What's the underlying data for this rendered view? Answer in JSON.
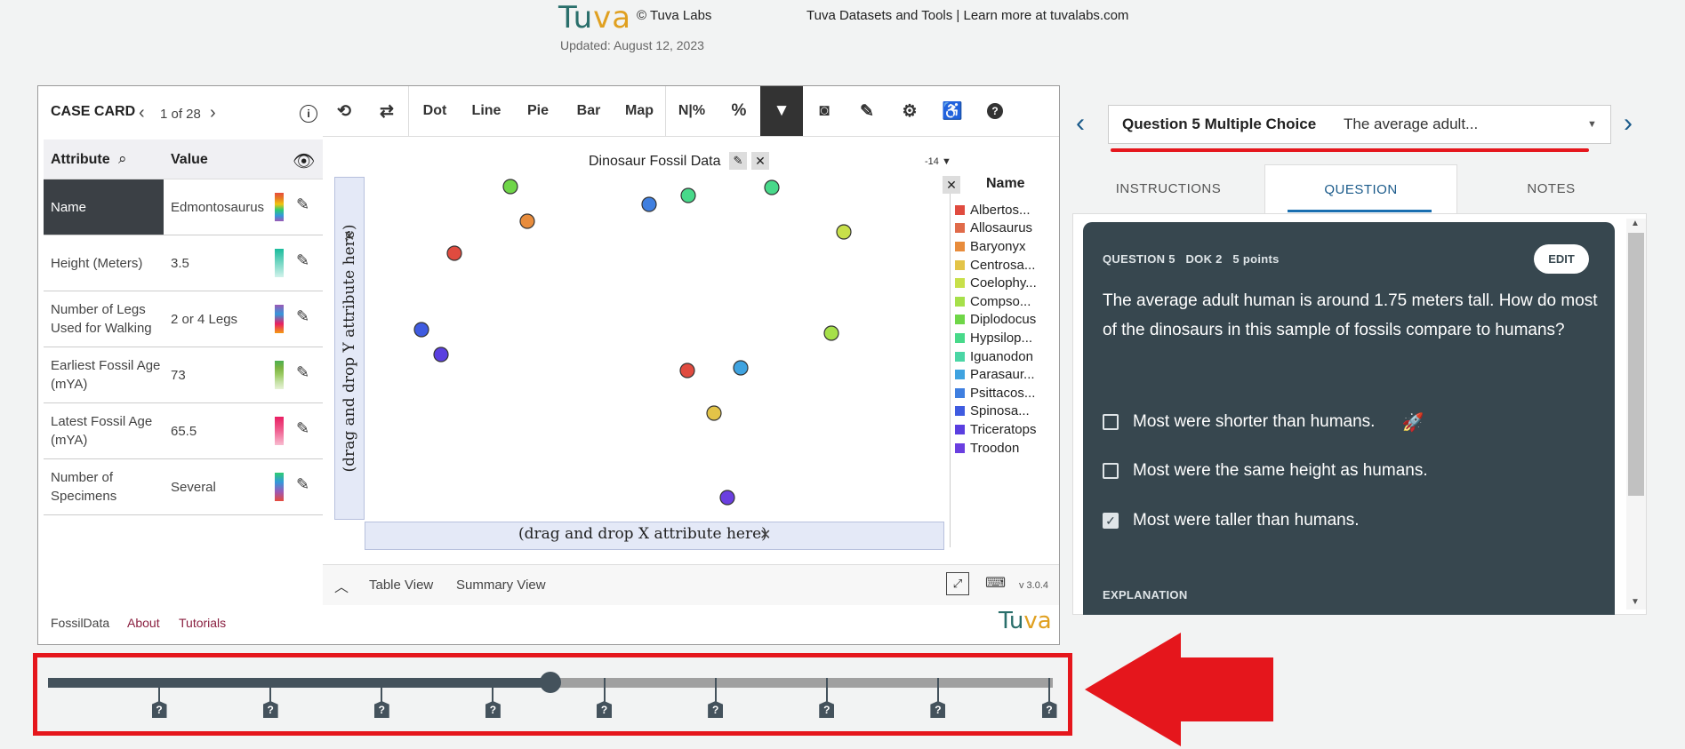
{
  "header": {
    "logo_text": "Tuva",
    "copyright": "© Tuva Labs",
    "updated": "Updated: August 12, 2023",
    "datasets_line": "Tuva Datasets and Tools | Learn more at tuvalabs.com"
  },
  "case_card": {
    "title": "CASE CARD",
    "position": "1 of 28",
    "col_attribute": "Attribute",
    "col_value": "Value",
    "rows": [
      {
        "attr": "Name",
        "value": "Edmontosaurus",
        "swatch": [
          "#e74c3c",
          "#e67e22",
          "#f1c40f",
          "#2ecc71",
          "#3498db",
          "#9b59b6"
        ]
      },
      {
        "attr": "Height (Meters)",
        "value": "3.5",
        "swatch": [
          "#1abc9c",
          "#48c9b0",
          "#76d7c4",
          "#a3e4d7",
          "#d1f2eb"
        ]
      },
      {
        "attr": "Number of Legs Used for Walking",
        "value": "2 or 4 Legs",
        "swatch": [
          "#9b59b6",
          "#3498db",
          "#e91e63",
          "#f39c12"
        ]
      },
      {
        "attr": "Earliest Fossil Age (mYA)",
        "value": "73",
        "swatch": [
          "#4caf50",
          "#7cb342",
          "#9ccc65",
          "#c5e1a5",
          "#e6f2d6"
        ]
      },
      {
        "attr": "Latest Fossil Age (mYA)",
        "value": "65.5",
        "swatch": [
          "#e91e63",
          "#ec407a",
          "#f06292",
          "#f48fb1",
          "#f8bbd0"
        ]
      },
      {
        "attr": "Number of Specimens",
        "value": "Several",
        "swatch": [
          "#2ecc71",
          "#3498db",
          "#9b59b6",
          "#e74c3c"
        ]
      }
    ]
  },
  "toolbar": {
    "dot": "Dot",
    "line": "Line",
    "pie": "Pie",
    "bar": "Bar",
    "map": "Map",
    "npct": "N|%"
  },
  "graph": {
    "title": "Dinosaur Fossil Data",
    "filter_count": "-14",
    "y_placeholder": "(drag and drop Y attribute here)",
    "x_placeholder": "(drag and drop X attribute here)",
    "legend_title": "Name",
    "legend": [
      {
        "label": "Albertos...",
        "color": "#e04b3f"
      },
      {
        "label": "Allosaurus",
        "color": "#e06b4a"
      },
      {
        "label": "Baryonyx",
        "color": "#e88c3c"
      },
      {
        "label": "Centrosa...",
        "color": "#e3c448"
      },
      {
        "label": "Coelophy...",
        "color": "#c8e04a"
      },
      {
        "label": "Compso...",
        "color": "#a6e04a"
      },
      {
        "label": "Diplodocus",
        "color": "#6fd648"
      },
      {
        "label": "Hypsilop...",
        "color": "#48d98a"
      },
      {
        "label": "Iguanodon",
        "color": "#4bd6a5"
      },
      {
        "label": "Parasaur...",
        "color": "#3fa3e0"
      },
      {
        "label": "Psittacos...",
        "color": "#3f7fe0"
      },
      {
        "label": "Spinosa...",
        "color": "#3f5be0"
      },
      {
        "label": "Triceratops",
        "color": "#5a3fe0"
      },
      {
        "label": "Troodon",
        "color": "#6a3fe0"
      }
    ],
    "points": [
      {
        "color": "#6fd648"
      },
      {
        "color": "#e88c3c"
      },
      {
        "color": "#e04b3f"
      },
      {
        "color": "#3f5be0"
      },
      {
        "color": "#5a3fe0"
      },
      {
        "color": "#3f7fe0"
      },
      {
        "color": "#48d98a"
      },
      {
        "color": "#48d98a"
      },
      {
        "color": "#c8e04a"
      },
      {
        "color": "#a6e04a"
      },
      {
        "color": "#e04b3f"
      },
      {
        "color": "#e3c448"
      },
      {
        "color": "#3fa3e0"
      },
      {
        "color": "#6a3fe0"
      }
    ],
    "table_view": "Table View",
    "summary_view": "Summary View",
    "version": "v 3.0.4"
  },
  "footer": {
    "dataset": "FossilData",
    "about": "About",
    "tutorials": "Tutorials",
    "logo_text": "Tuva"
  },
  "slider": {
    "progress": 0.5,
    "markers": [
      "?",
      "?",
      "?",
      "?",
      "?",
      "?",
      "?",
      "?",
      "?"
    ]
  },
  "question": {
    "selector_label": "Question 5 Multiple Choice",
    "selector_text": "The average adult...",
    "tabs": [
      "INSTRUCTIONS",
      "QUESTION",
      "NOTES"
    ],
    "meta": "QUESTION 5   DOK 2   5 points",
    "edit": "EDIT",
    "prompt": "The average adult human is around 1.75 meters tall. How do most of the dinosaurs in this sample of fossils compare to humans?",
    "options": [
      {
        "text": "Most were shorter than humans.",
        "checked": false
      },
      {
        "text": "Most were the same height as humans.",
        "checked": false
      },
      {
        "text": "Most were taller than humans.",
        "checked": true
      }
    ],
    "explanation_heading": "EXPLANATION"
  },
  "colors": {
    "accent_red": "#e5161c",
    "dark_panel": "#37474f",
    "slider": "#44525c",
    "link_blue": "#1a5a8a"
  }
}
